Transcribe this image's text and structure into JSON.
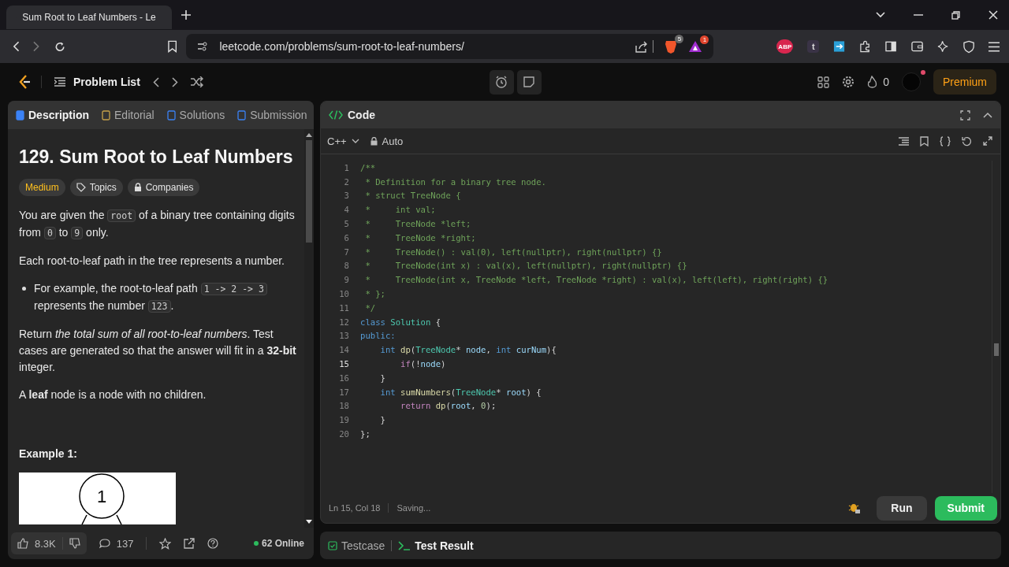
{
  "browser": {
    "tab_title": "Sum Root to Leaf Numbers - Le",
    "url": "leetcode.com/problems/sum-root-to-leaf-numbers/",
    "shield_count": "5",
    "rewards_count": "1",
    "extensions": [
      "ABP",
      "t"
    ]
  },
  "nav": {
    "problem_list": "Problem List",
    "streak": "0",
    "premium": "Premium"
  },
  "left_tabs": [
    {
      "label": "Description",
      "selected": true,
      "kind": "description"
    },
    {
      "label": "Editorial",
      "selected": false,
      "kind": "editorial"
    },
    {
      "label": "Solutions",
      "selected": false,
      "kind": "solutions"
    },
    {
      "label": "Submission",
      "selected": false,
      "kind": "submissions"
    }
  ],
  "problem": {
    "title": "129. Sum Root to Leaf Numbers",
    "tags": [
      {
        "label": "Medium",
        "kind": "difficulty"
      },
      {
        "label": "Topics",
        "kind": "topics"
      },
      {
        "label": "Companies",
        "kind": "companies"
      }
    ],
    "paragraphs": [
      {
        "kind": "para",
        "segments": [
          {
            "kind": "text",
            "t": "You are given the "
          },
          {
            "kind": "code",
            "t": "root"
          },
          {
            "kind": "text",
            "t": " of a binary tree containing digits from "
          },
          {
            "kind": "code",
            "t": "0"
          },
          {
            "kind": "text",
            "t": " to "
          },
          {
            "kind": "code",
            "t": "9"
          },
          {
            "kind": "text",
            "t": " only."
          }
        ]
      },
      {
        "kind": "para",
        "segments": [
          {
            "kind": "text",
            "t": "Each root-to-leaf path in the tree represents a number."
          }
        ]
      },
      {
        "kind": "bullet",
        "segments": [
          {
            "kind": "text",
            "t": "For example, the root-to-leaf path "
          },
          {
            "kind": "code",
            "t": "1 -> 2 -> 3"
          },
          {
            "kind": "text",
            "t": " represents the number "
          },
          {
            "kind": "code",
            "t": "123"
          },
          {
            "kind": "text",
            "t": "."
          }
        ]
      },
      {
        "kind": "para",
        "segments": [
          {
            "kind": "text",
            "t": "Return *the total sum of all root-to-leaf numbers*. Test cases are generated so that the answer will fit in a **32-bit** integer."
          }
        ]
      },
      {
        "kind": "para",
        "segments": [
          {
            "kind": "text",
            "t": "A **leaf** node is a node with no children."
          }
        ]
      }
    ],
    "example_heading": "Example 1:",
    "example_root": "1"
  },
  "left_footer": {
    "likes": "8.3K",
    "comments": "137",
    "online": "62 Online"
  },
  "editor": {
    "title": "Code",
    "language": "C++",
    "mode": "Auto",
    "lines": [
      {
        "number": "1",
        "current": false,
        "tokens": [
          {
            "kind": "comment",
            "t": "/**"
          }
        ]
      },
      {
        "number": "2",
        "current": false,
        "tokens": [
          {
            "kind": "comment",
            "t": " * Definition for a binary tree node."
          }
        ]
      },
      {
        "number": "3",
        "current": false,
        "tokens": [
          {
            "kind": "comment",
            "t": " * struct TreeNode {"
          }
        ]
      },
      {
        "number": "4",
        "current": false,
        "tokens": [
          {
            "kind": "comment",
            "t": " *     int val;"
          }
        ]
      },
      {
        "number": "5",
        "current": false,
        "tokens": [
          {
            "kind": "comment",
            "t": " *     TreeNode *left;"
          }
        ]
      },
      {
        "number": "6",
        "current": false,
        "tokens": [
          {
            "kind": "comment",
            "t": " *     TreeNode *right;"
          }
        ]
      },
      {
        "number": "7",
        "current": false,
        "tokens": [
          {
            "kind": "comment",
            "t": " *     TreeNode() : val(0), left(nullptr), right(nullptr) {}"
          }
        ]
      },
      {
        "number": "8",
        "current": false,
        "tokens": [
          {
            "kind": "comment",
            "t": " *     TreeNode(int x) : val(x), left(nullptr), right(nullptr) {}"
          }
        ]
      },
      {
        "number": "9",
        "current": false,
        "tokens": [
          {
            "kind": "comment",
            "t": " *     TreeNode(int x, TreeNode *left, TreeNode *right) : val(x), left(left), right(right) {}"
          }
        ]
      },
      {
        "number": "10",
        "current": false,
        "tokens": [
          {
            "kind": "comment",
            "t": " * };"
          }
        ]
      },
      {
        "number": "11",
        "current": false,
        "tokens": [
          {
            "kind": "comment",
            "t": " */"
          }
        ]
      },
      {
        "number": "12",
        "current": false,
        "tokens": [
          {
            "kind": "keyword",
            "t": "class "
          },
          {
            "kind": "type",
            "t": "Solution"
          },
          {
            "kind": "plain",
            "t": " {"
          }
        ]
      },
      {
        "number": "13",
        "current": false,
        "tokens": [
          {
            "kind": "keyword",
            "t": "public:"
          }
        ]
      },
      {
        "number": "14",
        "current": false,
        "tokens": [
          {
            "kind": "keyword",
            "t": "    int "
          },
          {
            "kind": "func",
            "t": "dp"
          },
          {
            "kind": "plain",
            "t": "("
          },
          {
            "kind": "type",
            "t": "TreeNode"
          },
          {
            "kind": "plain",
            "t": "* "
          },
          {
            "kind": "var",
            "t": "node"
          },
          {
            "kind": "plain",
            "t": ", "
          },
          {
            "kind": "keyword",
            "t": "int "
          },
          {
            "kind": "var",
            "t": "curNum"
          },
          {
            "kind": "plain",
            "t": "){"
          }
        ]
      },
      {
        "number": "15",
        "current": true,
        "tokens": [
          {
            "kind": "control",
            "t": "        if"
          },
          {
            "kind": "plain",
            "t": "(!"
          },
          {
            "kind": "var",
            "t": "node"
          },
          {
            "kind": "plain",
            "t": ")"
          }
        ]
      },
      {
        "number": "16",
        "current": false,
        "tokens": [
          {
            "kind": "plain",
            "t": "    }"
          }
        ]
      },
      {
        "number": "17",
        "current": false,
        "tokens": [
          {
            "kind": "keyword",
            "t": "    int "
          },
          {
            "kind": "func",
            "t": "sumNumbers"
          },
          {
            "kind": "plain",
            "t": "("
          },
          {
            "kind": "type",
            "t": "TreeNode"
          },
          {
            "kind": "plain",
            "t": "* "
          },
          {
            "kind": "var",
            "t": "root"
          },
          {
            "kind": "plain",
            "t": ") {"
          }
        ]
      },
      {
        "number": "18",
        "current": false,
        "tokens": [
          {
            "kind": "control",
            "t": "        return "
          },
          {
            "kind": "func",
            "t": "dp"
          },
          {
            "kind": "plain",
            "t": "("
          },
          {
            "kind": "var",
            "t": "root"
          },
          {
            "kind": "plain",
            "t": ", "
          },
          {
            "kind": "number",
            "t": "0"
          },
          {
            "kind": "plain",
            "t": ");"
          }
        ]
      },
      {
        "number": "19",
        "current": false,
        "tokens": [
          {
            "kind": "plain",
            "t": "    }"
          }
        ]
      },
      {
        "number": "20",
        "current": false,
        "tokens": [
          {
            "kind": "plain",
            "t": "};"
          }
        ]
      }
    ],
    "status": "Ln 15, Col 18",
    "saving": "Saving...",
    "run": "Run",
    "submit": "Submit"
  },
  "bottom_tabs": [
    {
      "label": "Testcase",
      "selected": false,
      "kind": "testcase"
    },
    {
      "label": "Test Result",
      "selected": true,
      "kind": "result"
    }
  ]
}
